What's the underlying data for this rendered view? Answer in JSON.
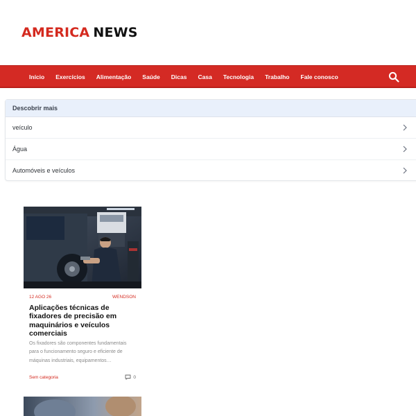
{
  "header": {
    "logo_word1": "AMERICA",
    "logo_word2": "NEWS"
  },
  "nav": {
    "items": [
      "Início",
      "Exercícios",
      "Alimentação",
      "Saúde",
      "Dicas",
      "Casa",
      "Tecnologia",
      "Trabalho",
      "Fale conosco"
    ],
    "search_icon": "search-icon"
  },
  "discover": {
    "heading": "Descobrir mais",
    "items": [
      "veículo",
      "Água",
      "Automóveis e veículos"
    ]
  },
  "post": {
    "date": "12 AGO 26",
    "author": "WENDSON",
    "title": "Aplicações técnicas de fixadores de precisão em maquinários e veículos comerciais",
    "excerpt": "Os fixadores são componentes fundamentais para o funcionamento seguro e eficiente de máquinas industriais, equipamentos…",
    "category": "Sem categoria",
    "comments": "0"
  },
  "colors": {
    "brand_red": "#d42a24",
    "nav_text": "#ffffff",
    "discover_bg": "#e9f0fb"
  }
}
